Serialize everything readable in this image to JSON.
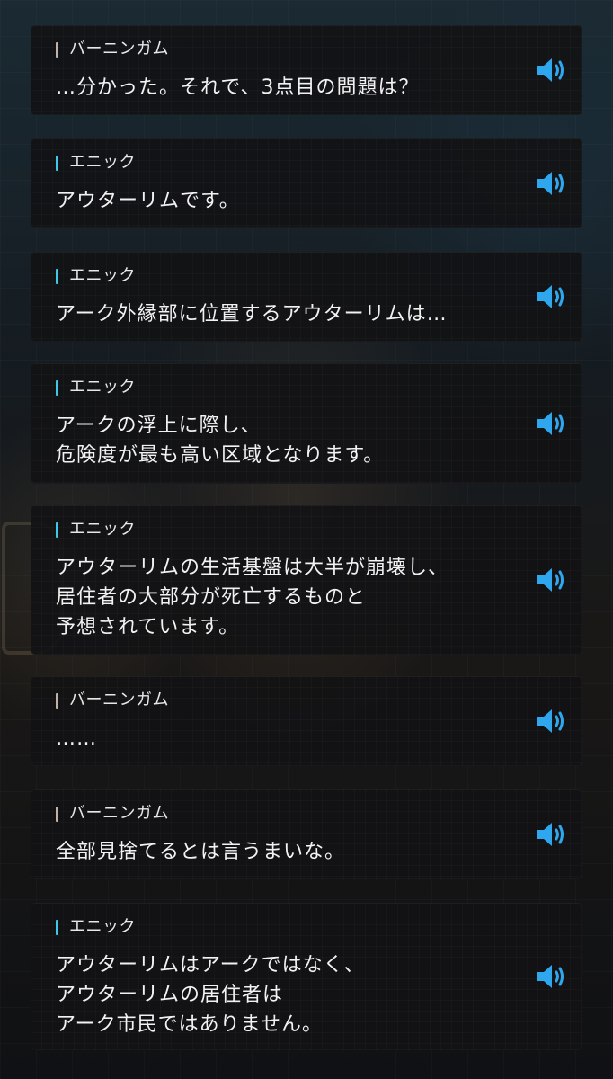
{
  "colors": {
    "accent_cyan": "#3fc8e8",
    "accent_gray": "#bfb3aa",
    "voice_blue": "#2fa7ee"
  },
  "log": [
    {
      "speaker": "バーニンガム",
      "speaker_style": "gray",
      "lines": [
        "…分かった。それで、3点目の問題は？"
      ],
      "voice_icon": "speaker-volume-icon"
    },
    {
      "speaker": "エニック",
      "speaker_style": "cyan",
      "lines": [
        "アウターリムです。"
      ],
      "voice_icon": "speaker-volume-icon"
    },
    {
      "speaker": "エニック",
      "speaker_style": "cyan",
      "lines": [
        "アーク外縁部に位置するアウターリムは…"
      ],
      "voice_icon": "speaker-volume-icon"
    },
    {
      "speaker": "エニック",
      "speaker_style": "cyan",
      "lines": [
        "アークの浮上に際し、",
        "危険度が最も高い区域となります。"
      ],
      "voice_icon": "speaker-volume-icon"
    },
    {
      "speaker": "エニック",
      "speaker_style": "cyan",
      "lines": [
        "アウターリムの生活基盤は大半が崩壊し、",
        "居住者の大部分が死亡するものと",
        "予想されています。"
      ],
      "voice_icon": "speaker-volume-icon"
    },
    {
      "speaker": "バーニンガム",
      "speaker_style": "gray",
      "lines": [
        "……"
      ],
      "voice_icon": "speaker-volume-icon"
    },
    {
      "speaker": "バーニンガム",
      "speaker_style": "gray",
      "lines": [
        "全部見捨てるとは言うまいな。"
      ],
      "voice_icon": "speaker-volume-icon"
    },
    {
      "speaker": "エニック",
      "speaker_style": "cyan",
      "lines": [
        "アウターリムはアークではなく、",
        "アウターリムの居住者は",
        "アーク市民ではありません。"
      ],
      "voice_icon": "speaker-volume-icon"
    }
  ]
}
